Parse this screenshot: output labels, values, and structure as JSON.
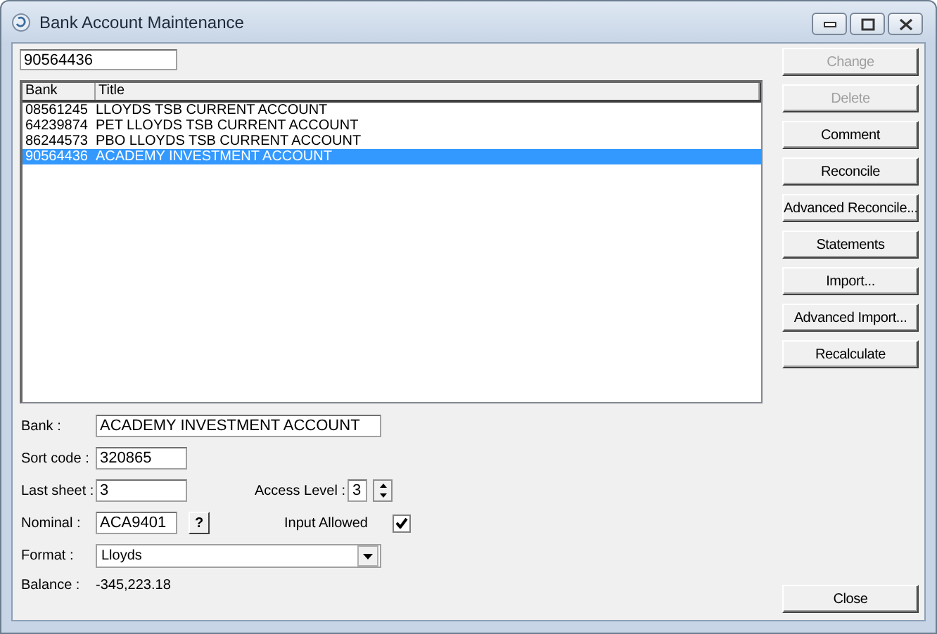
{
  "window": {
    "title": "Bank Account Maintenance"
  },
  "search": {
    "value": "90564436"
  },
  "table": {
    "columns": [
      "Bank",
      "Title"
    ],
    "rows": [
      {
        "cells": [
          "08561245",
          "LLOYDS TSB CURRENT ACCOUNT"
        ],
        "selected": false
      },
      {
        "cells": [
          "64239874",
          "PET LLOYDS TSB CURRENT ACCOUNT"
        ],
        "selected": false
      },
      {
        "cells": [
          "86244573",
          "PBO LLOYDS TSB CURRENT ACCOUNT"
        ],
        "selected": false
      },
      {
        "cells": [
          "90564436",
          "ACADEMY INVESTMENT ACCOUNT"
        ],
        "selected": true
      }
    ]
  },
  "form": {
    "bank": {
      "label": "Bank :",
      "value": "ACADEMY INVESTMENT ACCOUNT"
    },
    "sort_code": {
      "label": "Sort code :",
      "value": "320865"
    },
    "last_sheet": {
      "label": "Last sheet :",
      "value": "3"
    },
    "access_level": {
      "label": "Access Level :",
      "value": "3"
    },
    "nominal": {
      "label": "Nominal :",
      "value": "ACA9401",
      "lookup_button": "?"
    },
    "input_allowed": {
      "label": "Input Allowed",
      "checked": true
    },
    "format": {
      "label": "Format :",
      "value": "Lloyds"
    },
    "balance": {
      "label": "Balance :",
      "value": "-345,223.18"
    }
  },
  "buttons": [
    {
      "label": "Change",
      "disabled": true
    },
    {
      "label": "Delete",
      "disabled": true
    },
    {
      "label": "Comment",
      "disabled": false
    },
    {
      "label": "Reconcile",
      "disabled": false
    },
    {
      "label": "Advanced Reconcile...",
      "disabled": false
    },
    {
      "label": "Statements",
      "disabled": false
    },
    {
      "label": "Import...",
      "disabled": false
    },
    {
      "label": "Advanced Import...",
      "disabled": false
    },
    {
      "label": "Recalculate",
      "disabled": false
    }
  ],
  "close_button": {
    "label": "Close"
  }
}
